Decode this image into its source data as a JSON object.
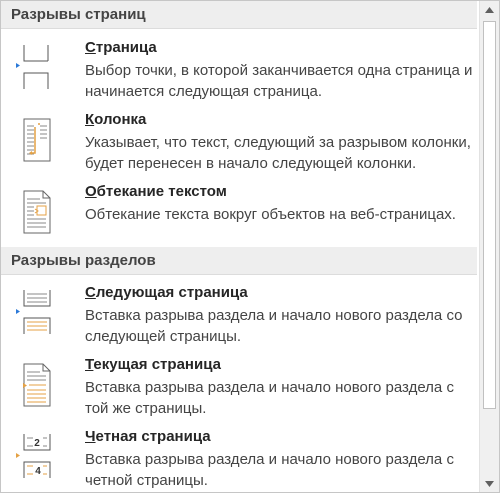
{
  "sections": {
    "page_breaks": {
      "header": "Разрывы страниц",
      "items": [
        {
          "title_accel": "С",
          "title_rest": "траница",
          "description": "Выбор точки, в которой заканчивается одна страница и начинается следующая страница.",
          "icon": "page-break-icon"
        },
        {
          "title_accel": "К",
          "title_rest": "олонка",
          "description": "Указывает, что текст, следующий за разрывом колонки, будет перенесен в начало следующей колонки.",
          "icon": "column-break-icon"
        },
        {
          "title_accel": "О",
          "title_rest": "бтекание текстом",
          "description": "Обтекание текста вокруг объектов на веб-страницах.",
          "icon": "text-wrapping-icon"
        }
      ]
    },
    "section_breaks": {
      "header": "Разрывы разделов",
      "items": [
        {
          "title_accel": "С",
          "title_rest": "ледующая страница",
          "description": "Вставка разрыва раздела и начало нового раздела со следующей страницы.",
          "icon": "next-page-section-icon"
        },
        {
          "title_accel": "Т",
          "title_rest": "екущая страница",
          "description": "Вставка разрыва раздела и начало нового раздела с той же страницы.",
          "icon": "continuous-section-icon"
        },
        {
          "title_accel": "Ч",
          "title_rest": "етная страница",
          "description": "Вставка разрыва раздела и начало нового раздела с четной страницы.",
          "icon": "even-page-section-icon",
          "icon_numbers": [
            "2",
            "4"
          ]
        }
      ]
    }
  },
  "colors": {
    "accent": "#2b79d8",
    "orange": "#e4a144",
    "header_bg": "#eeeeee"
  }
}
